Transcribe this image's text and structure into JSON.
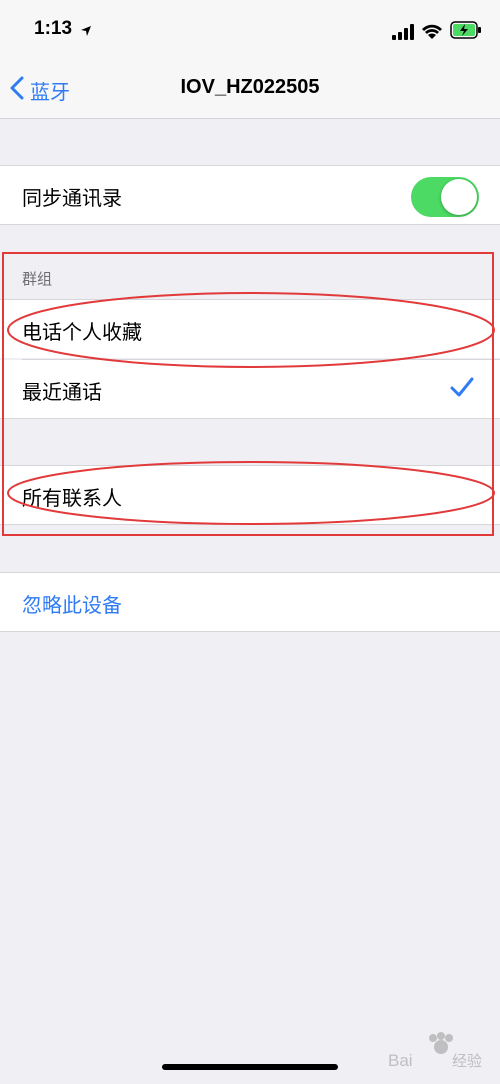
{
  "status": {
    "time": "1:13"
  },
  "nav": {
    "back_label": "蓝牙",
    "title": "IOV_HZ022505"
  },
  "sync": {
    "label": "同步通讯录",
    "enabled": true
  },
  "groups": {
    "header": "群组",
    "items": [
      {
        "label": "电话个人收藏",
        "selected": false
      },
      {
        "label": "最近通话",
        "selected": true
      }
    ],
    "all_contacts_label": "所有联系人"
  },
  "ignore_device": {
    "label": "忽略此设备"
  },
  "watermark": {
    "text": "Baidu 经验"
  },
  "colors": {
    "accent": "#2f7bf5",
    "toggle_on": "#4cd964",
    "annotation": "#e23a3a"
  }
}
